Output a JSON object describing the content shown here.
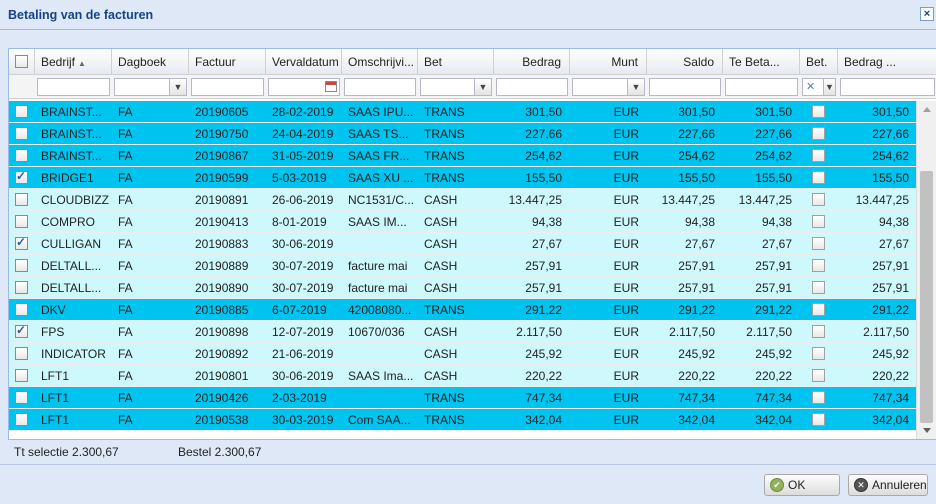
{
  "dialog": {
    "title": "Betaling van de facturen",
    "close_glyph": "×"
  },
  "columns": {
    "bedrijf": "Bedrijf",
    "dagboek": "Dagboek",
    "factuur": "Factuur",
    "vervaldatum": "Vervaldatum",
    "omschrijving": "Omschrijvi...",
    "bet": "Bet",
    "bedrag": "Bedrag",
    "munt": "Munt",
    "saldo": "Saldo",
    "te_betalen": "Te Beta...",
    "bet_flag": "Bet.",
    "bedrag2": "Bedrag ..."
  },
  "filter": {
    "bet_clear_glyph": "✕"
  },
  "rows": [
    {
      "sel": true,
      "checked": false,
      "bedrijf": "BRAINST...",
      "dagboek": "FA",
      "factuur": "20190605",
      "vervaldatum": "28-02-2019",
      "omschrijving": "SAAS IPU...",
      "bet": "TRANS",
      "bedrag": "301,50",
      "munt": "EUR",
      "saldo": "301,50",
      "te_betalen": "301,50",
      "bedrag2": "301,50"
    },
    {
      "sel": true,
      "checked": false,
      "bedrijf": "BRAINST...",
      "dagboek": "FA",
      "factuur": "20190750",
      "vervaldatum": "24-04-2019",
      "omschrijving": "SAAS TS...",
      "bet": "TRANS",
      "bedrag": "227,66",
      "munt": "EUR",
      "saldo": "227,66",
      "te_betalen": "227,66",
      "bedrag2": "227,66"
    },
    {
      "sel": true,
      "checked": false,
      "bedrijf": "BRAINST...",
      "dagboek": "FA",
      "factuur": "20190867",
      "vervaldatum": "31-05-2019",
      "omschrijving": "SAAS FR...",
      "bet": "TRANS",
      "bedrag": "254,62",
      "munt": "EUR",
      "saldo": "254,62",
      "te_betalen": "254,62",
      "bedrag2": "254,62"
    },
    {
      "sel": true,
      "checked": true,
      "bedrijf": "BRIDGE1",
      "dagboek": "FA",
      "factuur": "20190599",
      "vervaldatum": "5-03-2019",
      "omschrijving": "SAAS XU ...",
      "bet": "TRANS",
      "bedrag": "155,50",
      "munt": "EUR",
      "saldo": "155,50",
      "te_betalen": "155,50",
      "bedrag2": "155,50"
    },
    {
      "sel": false,
      "checked": false,
      "bedrijf": "CLOUDBIZZ",
      "dagboek": "FA",
      "factuur": "20190891",
      "vervaldatum": "26-06-2019",
      "omschrijving": "NC1531/C...",
      "bet": "CASH",
      "bedrag": "13.447,25",
      "munt": "EUR",
      "saldo": "13.447,25",
      "te_betalen": "13.447,25",
      "bedrag2": "13.447,25"
    },
    {
      "sel": false,
      "checked": false,
      "bedrijf": "COMPRO",
      "dagboek": "FA",
      "factuur": "20190413",
      "vervaldatum": "8-01-2019",
      "omschrijving": "SAAS IM...",
      "bet": "CASH",
      "bedrag": "94,38",
      "munt": "EUR",
      "saldo": "94,38",
      "te_betalen": "94,38",
      "bedrag2": "94,38"
    },
    {
      "sel": false,
      "checked": true,
      "bedrijf": "CULLIGAN",
      "dagboek": "FA",
      "factuur": "20190883",
      "vervaldatum": "30-06-2019",
      "omschrijving": "",
      "bet": "CASH",
      "bedrag": "27,67",
      "munt": "EUR",
      "saldo": "27,67",
      "te_betalen": "27,67",
      "bedrag2": "27,67"
    },
    {
      "sel": false,
      "checked": false,
      "bedrijf": "DELTALL...",
      "dagboek": "FA",
      "factuur": "20190889",
      "vervaldatum": "30-07-2019",
      "omschrijving": "facture mai",
      "bet": "CASH",
      "bedrag": "257,91",
      "munt": "EUR",
      "saldo": "257,91",
      "te_betalen": "257,91",
      "bedrag2": "257,91"
    },
    {
      "sel": false,
      "checked": false,
      "bedrijf": "DELTALL...",
      "dagboek": "FA",
      "factuur": "20190890",
      "vervaldatum": "30-07-2019",
      "omschrijving": "facture mai",
      "bet": "CASH",
      "bedrag": "257,91",
      "munt": "EUR",
      "saldo": "257,91",
      "te_betalen": "257,91",
      "bedrag2": "257,91"
    },
    {
      "sel": true,
      "checked": false,
      "bedrijf": "DKV",
      "dagboek": "FA",
      "factuur": "20190885",
      "vervaldatum": "6-07-2019",
      "omschrijving": "42008080...",
      "bet": "TRANS",
      "bedrag": "291,22",
      "munt": "EUR",
      "saldo": "291,22",
      "te_betalen": "291,22",
      "bedrag2": "291,22"
    },
    {
      "sel": false,
      "checked": true,
      "bedrijf": "FPS",
      "dagboek": "FA",
      "factuur": "20190898",
      "vervaldatum": "12-07-2019",
      "omschrijving": "10670/036",
      "bet": "CASH",
      "bedrag": "2.117,50",
      "munt": "EUR",
      "saldo": "2.117,50",
      "te_betalen": "2.117,50",
      "bedrag2": "2.117,50"
    },
    {
      "sel": false,
      "checked": false,
      "bedrijf": "INDICATOR",
      "dagboek": "FA",
      "factuur": "20190892",
      "vervaldatum": "21-06-2019",
      "omschrijving": "",
      "bet": "CASH",
      "bedrag": "245,92",
      "munt": "EUR",
      "saldo": "245,92",
      "te_betalen": "245,92",
      "bedrag2": "245,92"
    },
    {
      "sel": false,
      "checked": false,
      "bedrijf": "LFT1",
      "dagboek": "FA",
      "factuur": "20190801",
      "vervaldatum": "30-06-2019",
      "omschrijving": "SAAS Ima...",
      "bet": "CASH",
      "bedrag": "220,22",
      "munt": "EUR",
      "saldo": "220,22",
      "te_betalen": "220,22",
      "bedrag2": "220,22"
    },
    {
      "sel": true,
      "checked": false,
      "bedrijf": "LFT1",
      "dagboek": "FA",
      "factuur": "20190426",
      "vervaldatum": "2-03-2019",
      "omschrijving": "",
      "bet": "TRANS",
      "bedrag": "747,34",
      "munt": "EUR",
      "saldo": "747,34",
      "te_betalen": "747,34",
      "bedrag2": "747,34"
    },
    {
      "sel": true,
      "checked": false,
      "bedrijf": "LFT1",
      "dagboek": "FA",
      "factuur": "20190538",
      "vervaldatum": "30-03-2019",
      "omschrijving": "Com SAA...",
      "bet": "TRANS",
      "bedrag": "342,04",
      "munt": "EUR",
      "saldo": "342,04",
      "te_betalen": "342,04",
      "bedrag2": "342,04"
    }
  ],
  "status": {
    "selection": "Tt selectie 2.300,67",
    "bestel": "Bestel 2.300,67"
  },
  "buttons": {
    "ok": "OK",
    "cancel": "Annuleren"
  },
  "colors": {
    "selected_row": "#00c4f0",
    "row": "#cdf8fc",
    "header_text": "#15428b"
  }
}
